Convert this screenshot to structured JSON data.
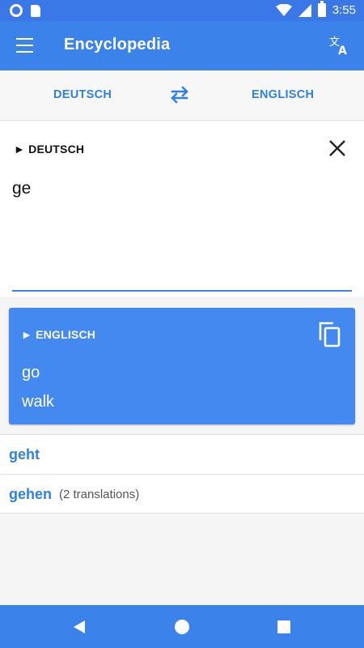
{
  "status_bar": {
    "time": "3:55",
    "icons": [
      "notification-circle-icon",
      "sd-card-icon",
      "wifi-icon",
      "signal-icon",
      "battery-icon"
    ]
  },
  "app_bar": {
    "title": "Encyclopedia",
    "menu_icon": "menu-icon",
    "translate_icon": "translate-icon"
  },
  "language_bar": {
    "source": "DEUTSCH",
    "target": "ENGLISCH",
    "swap_icon": "swap-icon"
  },
  "input_card": {
    "language_label": "► DEUTSCH",
    "text": "ge",
    "clear_icon": "close-icon"
  },
  "result_card": {
    "language_label": "► ENGLISCH",
    "translations": [
      "go",
      "walk"
    ],
    "copy_icon": "copy-icon"
  },
  "suggestions": [
    {
      "word": "geht",
      "info": ""
    },
    {
      "word": "gehen",
      "info": "(2 translations)"
    }
  ],
  "colors": {
    "primary": "#3b82eb",
    "accent_text": "#2f80e6",
    "result_card_bg": "#4389f0"
  }
}
